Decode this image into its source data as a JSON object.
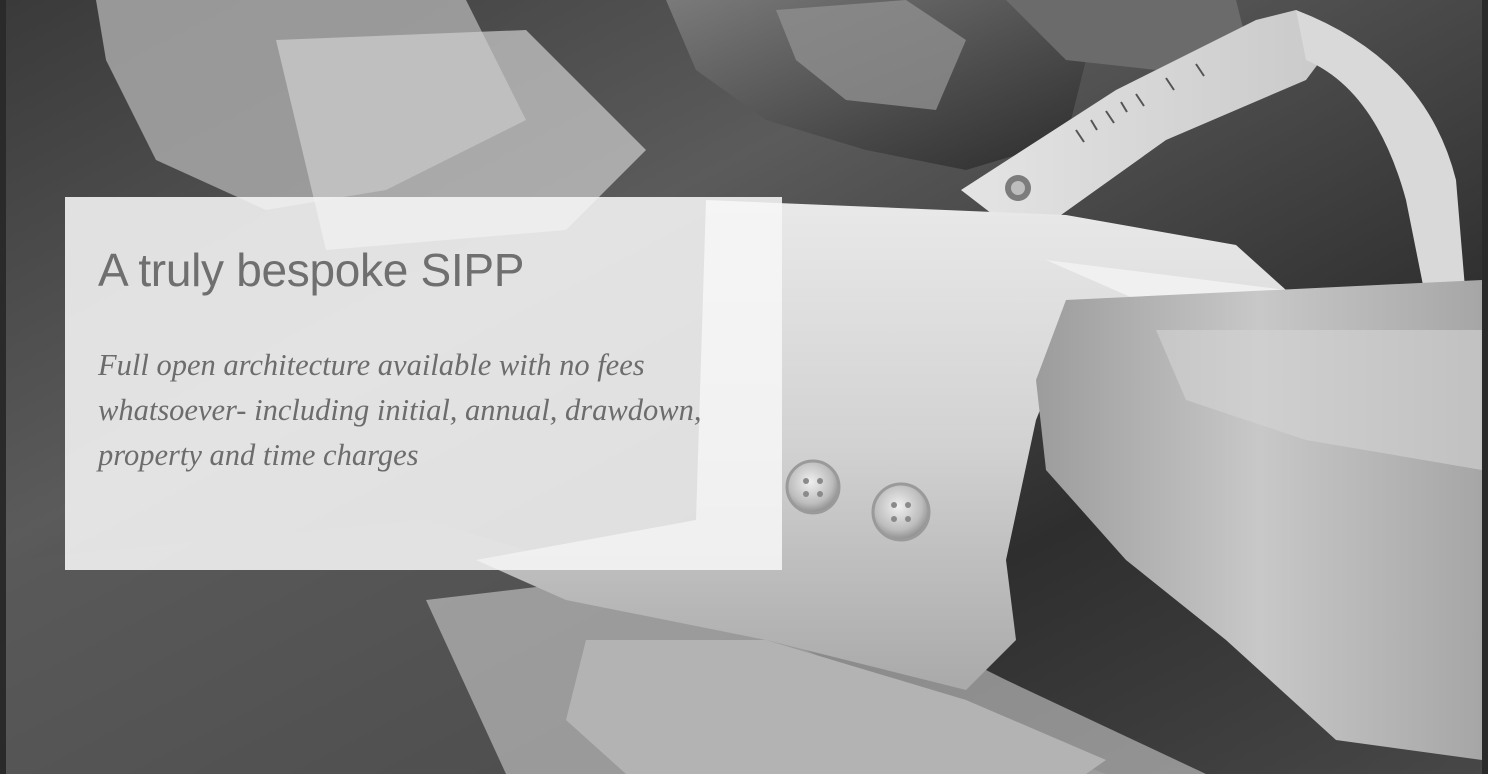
{
  "hero": {
    "title": "A truly bespoke SIPP",
    "description": "Full open architecture available with no fees whatsoever- including initial, annual, drawdown, property and time charges",
    "image": "tailor-measuring-shirt-cuff-photo",
    "colors": {
      "panel_background": "#f6f6f6",
      "title_text": "#6f6f6f",
      "description_text": "#6c6c6c"
    }
  }
}
